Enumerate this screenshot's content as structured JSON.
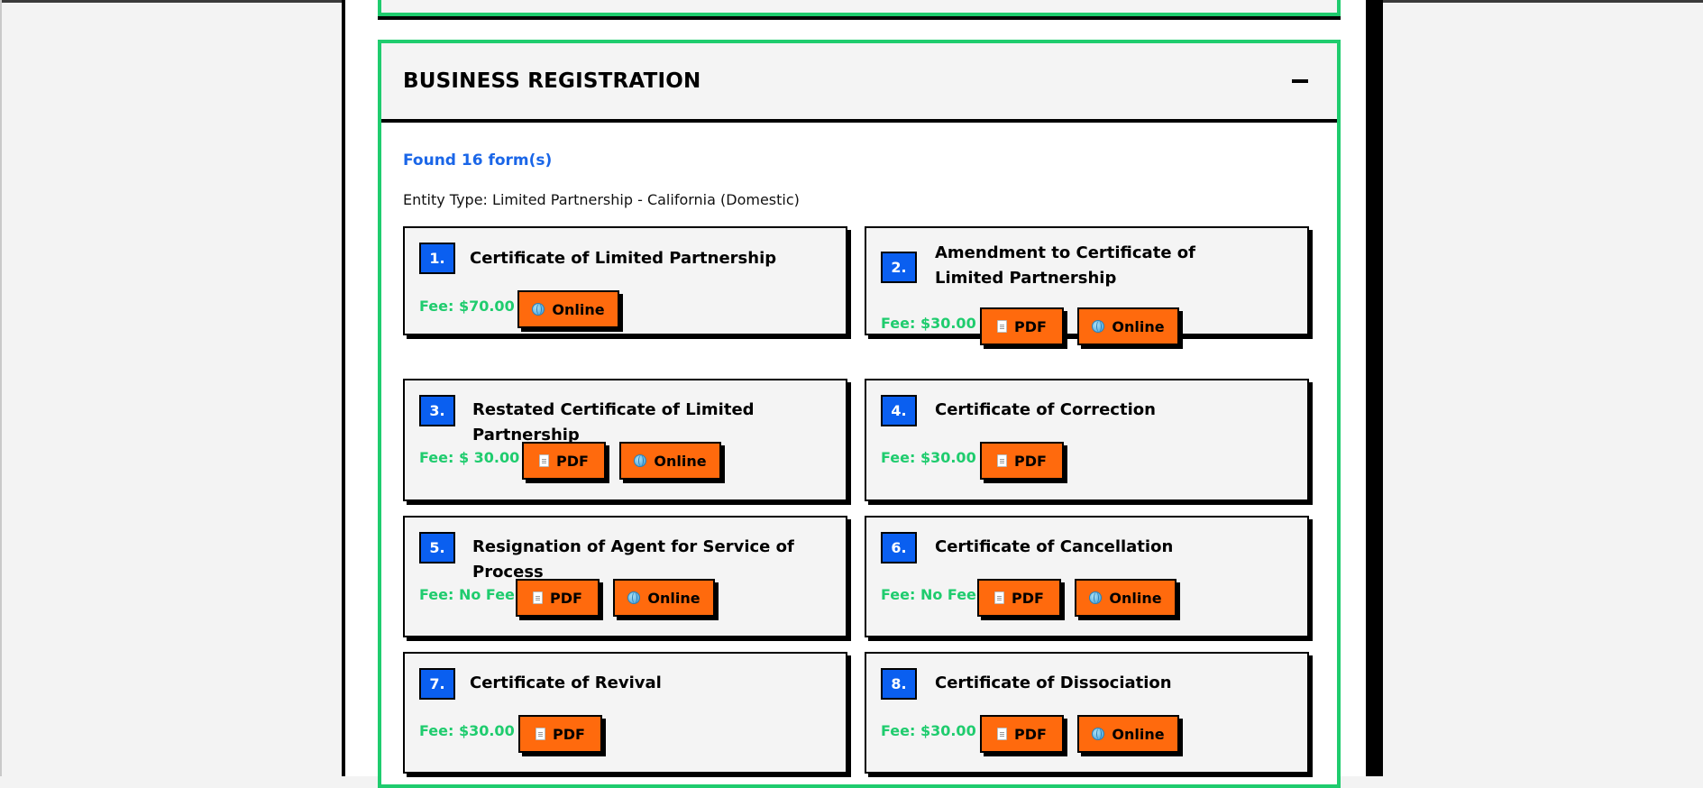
{
  "section": {
    "title": "BUSINESS REGISTRATION",
    "found": "Found 16 form(s)",
    "entity": "Entity Type: Limited Partnership - California (Domestic)"
  },
  "forms": [
    {
      "num": "1.",
      "title": "Certificate of Limited Partnership",
      "fee": "Fee: $70.00",
      "buttons": [
        "Online"
      ]
    },
    {
      "num": "2.",
      "title": "Amendment to Certificate of Limited Partnership",
      "fee": "Fee: $30.00",
      "buttons": [
        "PDF",
        "Online"
      ]
    },
    {
      "num": "3.",
      "title": "Restated Certificate of Limited Partnership",
      "fee": "Fee: $ 30.00",
      "buttons": [
        "PDF",
        "Online"
      ]
    },
    {
      "num": "4.",
      "title": "Certificate of Correction",
      "fee": "Fee: $30.00",
      "buttons": [
        "PDF"
      ]
    },
    {
      "num": "5.",
      "title": "Resignation of Agent for Service of Process",
      "fee": "Fee: No Fee",
      "buttons": [
        "PDF",
        "Online"
      ]
    },
    {
      "num": "6.",
      "title": "Certificate of Cancellation",
      "fee": "Fee: No Fee",
      "buttons": [
        "PDF",
        "Online"
      ]
    },
    {
      "num": "7.",
      "title": "Certificate of Revival",
      "fee": "Fee: $30.00",
      "buttons": [
        "PDF"
      ]
    },
    {
      "num": "8.",
      "title": "Certificate of Dissociation",
      "fee": "Fee: $30.00",
      "buttons": [
        "PDF",
        "Online"
      ]
    }
  ],
  "labels": {
    "pdf": "PDF",
    "online": "Online"
  },
  "icons": {
    "pdf": "document-icon",
    "online": "globe-icon",
    "collapse": "minus-icon"
  },
  "colors": {
    "accent_green": "#1fcc6e",
    "number_blue": "#0a5ff0",
    "button_orange": "#ff6a0d",
    "found_blue": "#1a66e8"
  }
}
